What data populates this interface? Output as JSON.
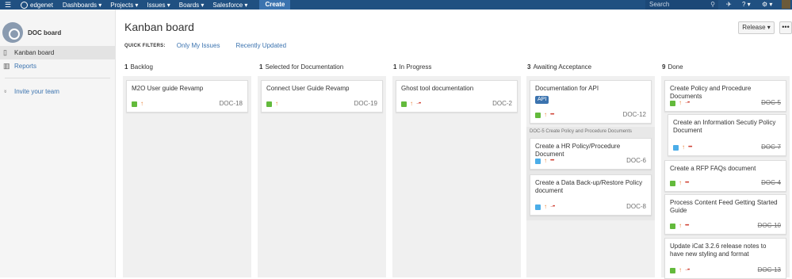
{
  "topbar": {
    "brand": "edgenet",
    "nav": [
      "Dashboards ▾",
      "Projects ▾",
      "Issues ▾",
      "Boards ▾",
      "Salesforce ▾"
    ],
    "create": "Create",
    "search_placeholder": "Search",
    "icons": [
      "menu-icon",
      "edgenet-logo-icon",
      "search-icon",
      "megaphone-icon",
      "help-icon",
      "gear-icon",
      "user-avatar-icon"
    ]
  },
  "sidebar": {
    "board_name": "DOC board",
    "items": [
      {
        "label": "Kanban board",
        "icon": "board-icon"
      },
      {
        "label": "Reports",
        "icon": "reports-icon"
      }
    ],
    "invite": "Invite your team"
  },
  "main": {
    "title": "Kanban board",
    "quick_filters_label": "QUICK FILTERS:",
    "quick_filters": [
      "Only My Issues",
      "Recently Updated"
    ],
    "release_button": "Release ▾",
    "more_button": "•••"
  },
  "columns": [
    {
      "count": "1",
      "name": "Backlog"
    },
    {
      "count": "1",
      "name": "Selected for Documentation"
    },
    {
      "count": "1",
      "name": "In Progress"
    },
    {
      "count": "3",
      "name": "Awaiting Acceptance"
    },
    {
      "count": "9",
      "name": "Done"
    }
  ],
  "cards": {
    "backlog": [
      {
        "summary": "M2O User guide Revamp",
        "key": "DOC-18"
      }
    ],
    "selected": [
      {
        "summary": "Connect User Guide Revamp",
        "key": "DOC-19"
      }
    ],
    "in_progress": [
      {
        "summary": "Ghost tool documentation",
        "key": "DOC-2"
      }
    ],
    "awaiting": [
      {
        "summary": "Documentation for API",
        "label": "API",
        "key": "DOC-12"
      }
    ],
    "awaiting_parent": "DOC-5 Create Policy and Procedure Documents",
    "awaiting_sub": [
      {
        "summary": "Create a HR Policy/Procedure Document",
        "key": "DOC-6"
      },
      {
        "summary": "Create a Data Back-up/Restore Policy document",
        "key": "DOC-8"
      }
    ],
    "done": [
      {
        "summary": "Create Policy and Procedure Documents",
        "key": "DOC-5"
      },
      {
        "summary": "Create an Information Secutiy Policy Document",
        "key": "DOC-7"
      },
      {
        "summary": "Create a RFP FAQs document",
        "key": "DOC-4"
      },
      {
        "summary": "Process Content Feed Getting Started Guide",
        "key": "DOC-10"
      },
      {
        "summary": "Update iCat 3.2.6 release notes to have new styling and format",
        "key": "DOC-13"
      }
    ]
  },
  "colors": {
    "topbar": "#205081",
    "link": "#3b73af",
    "story": "#63ba3c",
    "task": "#4bade8",
    "priority": "#e97f33",
    "dots": "#d04437"
  }
}
